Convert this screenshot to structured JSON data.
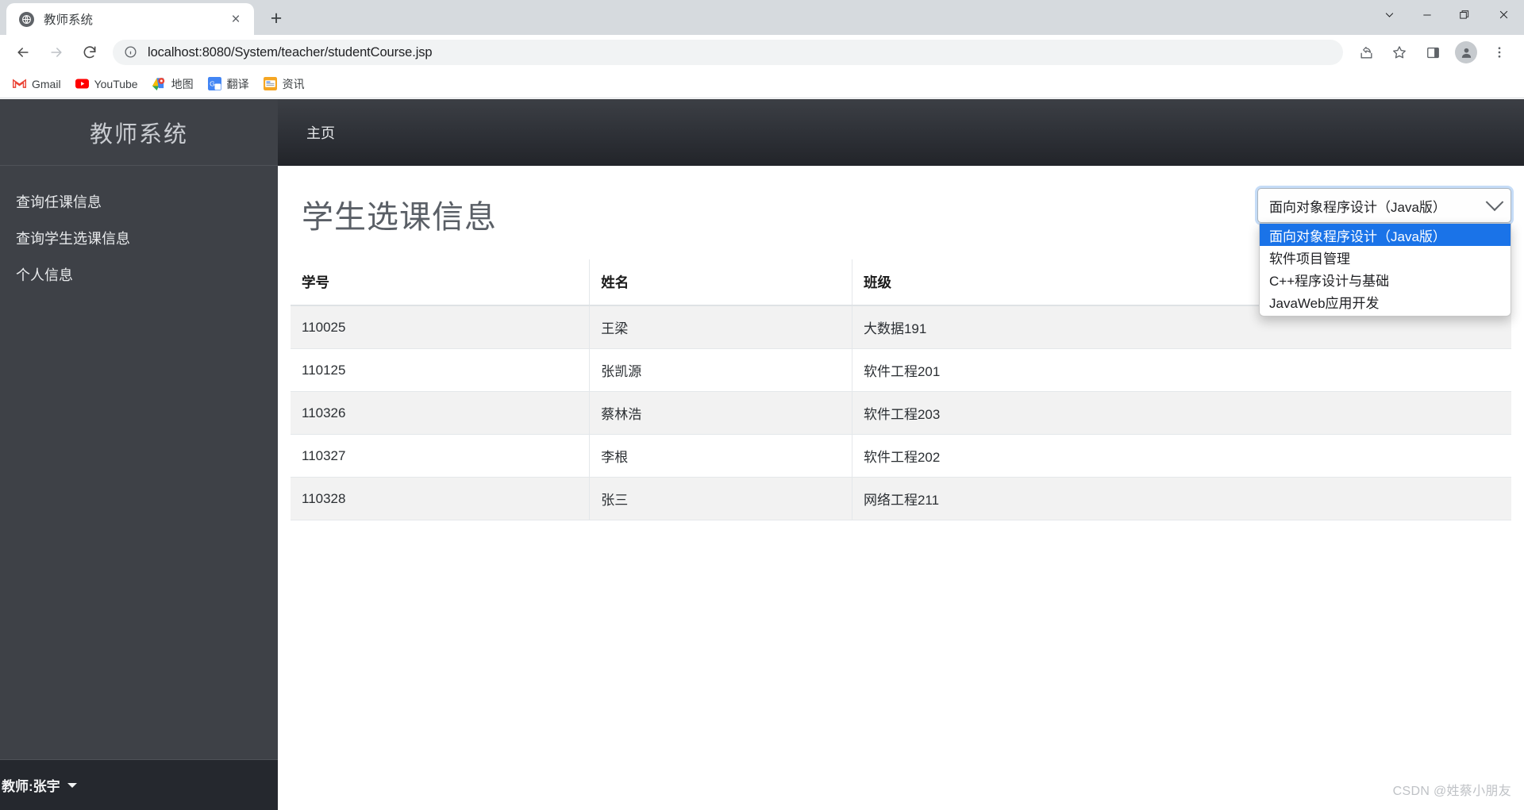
{
  "browser": {
    "tab": {
      "title": "教师系统",
      "favicon": "globe-icon",
      "close": "×"
    },
    "newtab_label": "+",
    "window_controls": {
      "chevron": "chevron-down-icon",
      "minimize": "minimize-icon",
      "restore": "restore-icon",
      "close": "close-icon"
    },
    "nav": {
      "back": "back-arrow-icon",
      "forward": "forward-arrow-icon",
      "reload": "reload-icon"
    },
    "omnibox": {
      "url": "localhost:8080/System/teacher/studentCourse.jsp",
      "info_icon": "info-circle-icon"
    },
    "toolbar_icons": [
      "share-icon",
      "star-icon",
      "side-panel-icon",
      "profile-avatar-icon",
      "kebab-menu-icon"
    ],
    "bookmarks": [
      {
        "label": "Gmail",
        "icon": "gmail-icon"
      },
      {
        "label": "YouTube",
        "icon": "youtube-icon"
      },
      {
        "label": "地图",
        "icon": "google-maps-icon"
      },
      {
        "label": "翻译",
        "icon": "google-translate-icon"
      },
      {
        "label": "资讯",
        "icon": "google-news-icon"
      }
    ]
  },
  "sidebar": {
    "brand": "教师系统",
    "items": [
      {
        "label": "查询任课信息"
      },
      {
        "label": "查询学生选课信息"
      },
      {
        "label": "个人信息"
      }
    ],
    "footer": {
      "label": "教师:张宇"
    }
  },
  "topnav": {
    "home": "主页"
  },
  "main": {
    "title": "学生选课信息",
    "course_select": {
      "value": "面向对象程序设计（Java版）",
      "expanded": true,
      "options": [
        "面向对象程序设计（Java版）",
        "软件项目管理",
        "C++程序设计与基础",
        "JavaWeb应用开发"
      ],
      "selected_index": 0
    },
    "table": {
      "columns": [
        "学号",
        "姓名",
        "班级"
      ],
      "rows": [
        [
          "110025",
          "王梁",
          "大数据191"
        ],
        [
          "110125",
          "张凯源",
          "软件工程201"
        ],
        [
          "110326",
          "蔡林浩",
          "软件工程203"
        ],
        [
          "110327",
          "李根",
          "软件工程202"
        ],
        [
          "110328",
          "张三",
          "网络工程211"
        ]
      ]
    }
  },
  "watermark": "CSDN @姓蔡小朋友",
  "colors": {
    "sidebar_bg": "#3e4147",
    "sidebar_footer_bg": "#25282e",
    "topnav_bg": "#2c2f35",
    "select_highlight": "#1a73e8",
    "row_alt_bg": "#f2f2f2"
  }
}
